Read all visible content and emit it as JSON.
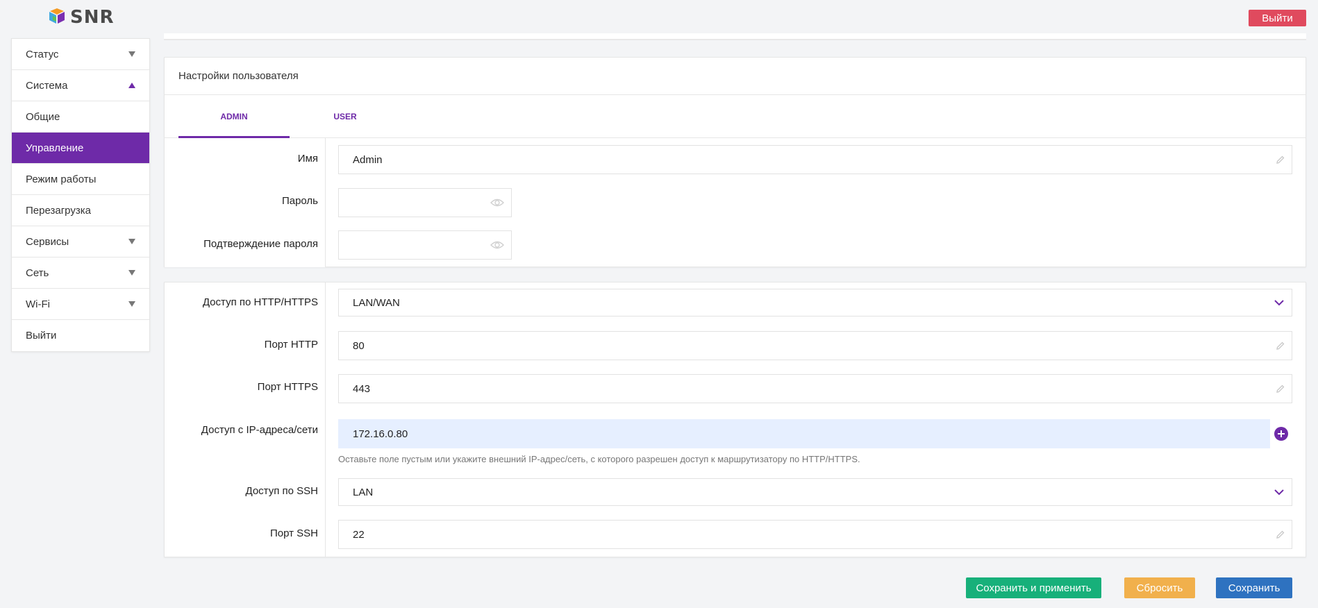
{
  "header": {
    "logo_text": "SNR",
    "logout_label": "Выйти"
  },
  "sidebar": {
    "items": [
      {
        "label": "Статус",
        "arrow": "down"
      },
      {
        "label": "Система",
        "arrow": "up"
      },
      {
        "label": "Общие",
        "arrow": ""
      },
      {
        "label": "Управление",
        "arrow": "",
        "active": true
      },
      {
        "label": "Режим работы",
        "arrow": ""
      },
      {
        "label": "Перезагрузка",
        "arrow": ""
      },
      {
        "label": "Сервисы",
        "arrow": "down"
      },
      {
        "label": "Сеть",
        "arrow": "down"
      },
      {
        "label": "Wi-Fi",
        "arrow": "down"
      },
      {
        "label": "Выйти",
        "arrow": ""
      }
    ]
  },
  "user_settings": {
    "title": "Настройки пользователя",
    "tabs": [
      "ADMIN",
      "USER"
    ],
    "name_label": "Имя",
    "name_value": "Admin",
    "password_label": "Пароль",
    "password_value": "",
    "confirm_label": "Подтверждение пароля",
    "confirm_value": ""
  },
  "access": {
    "http_access_label": "Доступ по HTTP/HTTPS",
    "http_access_value": "LAN/WAN",
    "http_port_label": "Порт HTTP",
    "http_port_value": "80",
    "https_port_label": "Порт HTTPS",
    "https_port_value": "443",
    "ip_access_label": "Доступ с IP-адреса/сети",
    "ip_access_value": "172.16.0.80",
    "ip_hint": "Оставьте поле пустым или укажите внешний IP-адрес/сеть, с которого разрешен доступ к маршрутизатору по HTTP/HTTPS.",
    "ssh_access_label": "Доступ по SSH",
    "ssh_access_value": "LAN",
    "ssh_port_label": "Порт SSH",
    "ssh_port_value": "22"
  },
  "actions": {
    "apply_label": "Сохранить и применить",
    "reset_label": "Сбросить",
    "save_label": "Сохранить"
  },
  "colors": {
    "accent": "#6e2aa8",
    "logout": "#e04a5e",
    "apply": "#17b07a",
    "reset": "#f1b04c",
    "save": "#2e72c0"
  }
}
